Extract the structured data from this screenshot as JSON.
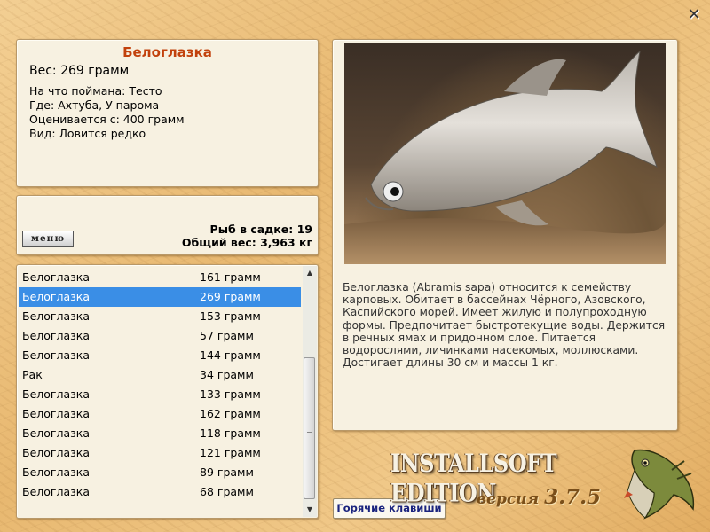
{
  "fish": {
    "title": "Белоглазка",
    "weight": "Вес: 269 грамм",
    "caught_on": "На что поймана: Тесто",
    "location": "Где: Ахтуба, У парома",
    "rated_from": "Оценивается с: 400 грамм",
    "kind": "Вид: Ловится редко"
  },
  "cage": {
    "menu_label": "меню",
    "count": "Рыб в садке: 19",
    "total_weight": "Общий вес: 3,963 кг"
  },
  "catch_list": {
    "selected_index": 1,
    "items": [
      {
        "name": "Белоглазка",
        "weight": "161 грамм"
      },
      {
        "name": "Белоглазка",
        "weight": "269 грамм"
      },
      {
        "name": "Белоглазка",
        "weight": "153 грамм"
      },
      {
        "name": "Белоглазка",
        "weight": "57 грамм"
      },
      {
        "name": "Белоглазка",
        "weight": "144 грамм"
      },
      {
        "name": "Рак",
        "weight": "34 грамм"
      },
      {
        "name": "Белоглазка",
        "weight": "133 грамм"
      },
      {
        "name": "Белоглазка",
        "weight": "162 грамм"
      },
      {
        "name": "Белоглазка",
        "weight": "118 грамм"
      },
      {
        "name": "Белоглазка",
        "weight": "121 грамм"
      },
      {
        "name": "Белоглазка",
        "weight": "89 грамм"
      },
      {
        "name": "Белоглазка",
        "weight": "68 грамм"
      }
    ]
  },
  "description": "Белоглазка (Abramis sapa) относится к семейству карповых. Обитает в бассейнах Чёрного, Азовского, Каспийского морей. Имеет жилую и полупроходную формы. Предпочитает быстротекущие воды. Держится в речных ямах и придонном слое. Питается водорослями, личинками насекомых, моллюсками. Достигает длины 30 см и массы 1 кг.",
  "hotkeys_label": "Горячие клавиши",
  "brand": {
    "edition": "INSTALLSOFT EDITION",
    "version_label": "версия",
    "version_number": "3.7.5"
  },
  "icons": {
    "close": "close-icon",
    "scroll_up": "chevron-up-icon",
    "scroll_down": "chevron-down-icon",
    "logo": "pike-fish-logo"
  },
  "colors": {
    "title": "#c2410c",
    "selection": "#3a8ee6",
    "hotkeys_text": "#1a237e"
  }
}
